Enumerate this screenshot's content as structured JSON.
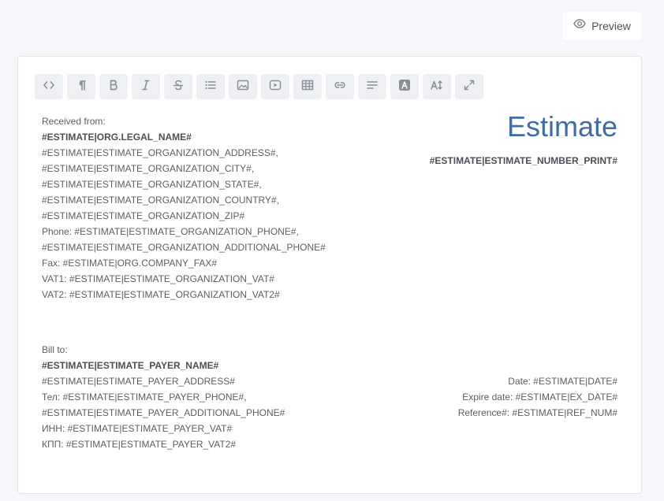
{
  "preview_button": {
    "label": "Preview",
    "icon": "eye-icon"
  },
  "toolbar": {
    "buttons": [
      {
        "name": "code-view-button",
        "icon": "code-icon"
      },
      {
        "name": "paragraph-button",
        "icon": "paragraph-icon"
      },
      {
        "name": "bold-button",
        "icon": "bold-icon"
      },
      {
        "name": "italic-button",
        "icon": "italic-icon"
      },
      {
        "name": "strikethrough-button",
        "icon": "strikethrough-icon"
      },
      {
        "name": "list-button",
        "icon": "list-icon"
      },
      {
        "name": "image-button",
        "icon": "image-icon"
      },
      {
        "name": "video-button",
        "icon": "video-icon"
      },
      {
        "name": "table-button",
        "icon": "table-icon"
      },
      {
        "name": "link-button",
        "icon": "link-icon"
      },
      {
        "name": "align-button",
        "icon": "align-left-icon"
      },
      {
        "name": "text-color-button",
        "icon": "text-color-icon"
      },
      {
        "name": "font-size-button",
        "icon": "font-size-icon"
      },
      {
        "name": "fullscreen-button",
        "icon": "expand-icon"
      }
    ]
  },
  "document": {
    "received_from_label": "Received from:",
    "org_legal_name": "#ESTIMATE|ORG.LEGAL_NAME#",
    "org_lines": [
      "#ESTIMATE|ESTIMATE_ORGANIZATION_ADDRESS#,",
      "#ESTIMATE|ESTIMATE_ORGANIZATION_CITY#,",
      "#ESTIMATE|ESTIMATE_ORGANIZATION_STATE#,",
      "#ESTIMATE|ESTIMATE_ORGANIZATION_COUNTRY#,",
      "#ESTIMATE|ESTIMATE_ORGANIZATION_ZIP#",
      "Phone: #ESTIMATE|ESTIMATE_ORGANIZATION_PHONE#,",
      "#ESTIMATE|ESTIMATE_ORGANIZATION_ADDITIONAL_PHONE#",
      "Fax: #ESTIMATE|ORG.COMPANY_FAX#",
      "VAT1: #ESTIMATE|ESTIMATE_ORGANIZATION_VAT#",
      "VAT2: #ESTIMATE|ESTIMATE_ORGANIZATION_VAT2#"
    ],
    "title": "Estimate",
    "number_print": "#ESTIMATE|ESTIMATE_NUMBER_PRINT#",
    "bill_to_label": "Bill to:",
    "payer_name": "#ESTIMATE|ESTIMATE_PAYER_NAME#",
    "payer_lines": [
      "#ESTIMATE|ESTIMATE_PAYER_ADDRESS#",
      "Тел: #ESTIMATE|ESTIMATE_PAYER_PHONE#,",
      "#ESTIMATE|ESTIMATE_PAYER_ADDITIONAL_PHONE#",
      "ИНН: #ESTIMATE|ESTIMATE_PAYER_VAT#",
      "КПП: #ESTIMATE|ESTIMATE_PAYER_VAT2#"
    ],
    "date_line": "Date: #ESTIMATE|DATE#",
    "expire_line": "Expire date: #ESTIMATE|EX_DATE#",
    "reference_line": "Reference#: #ESTIMATE|REF_NUM#"
  },
  "colors": {
    "background": "#f6f7fb",
    "title_blue": "#3f6ba8",
    "toolbar_button": "#eef0f4",
    "icon_gray": "#8a8f99"
  }
}
